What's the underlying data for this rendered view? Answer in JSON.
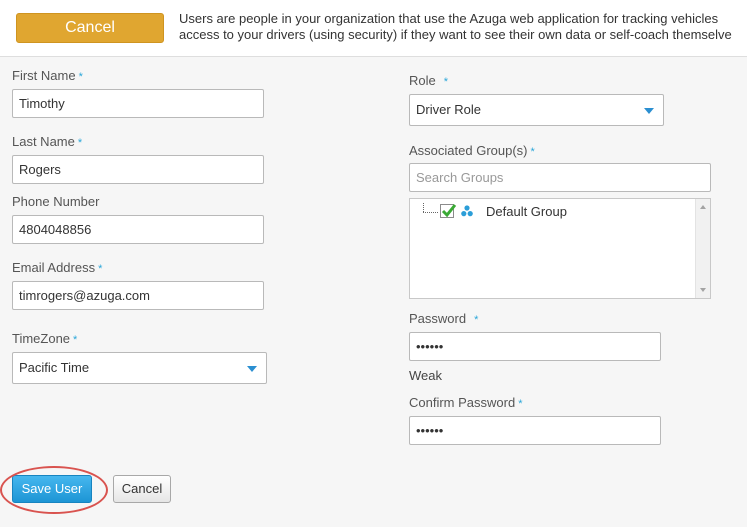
{
  "header": {
    "cancel_label": "Cancel",
    "info_line1": "Users are people in your organization that use the Azuga web application for tracking vehicles",
    "info_line2": "access to your drivers (using security) if they want to see their own data or self-coach themselve"
  },
  "form": {
    "required_mark": "*",
    "first_name": {
      "label": "First Name",
      "value": "Timothy"
    },
    "last_name": {
      "label": "Last Name",
      "value": "Rogers"
    },
    "phone": {
      "label": "Phone Number",
      "value": "4804048856"
    },
    "email": {
      "label": "Email Address",
      "value": "timrogers@azuga.com"
    },
    "timezone": {
      "label": "TimeZone",
      "value": "Pacific Time"
    },
    "role": {
      "label": "Role",
      "value": "Driver Role"
    },
    "groups": {
      "label": "Associated Group(s)",
      "search_placeholder": "Search Groups",
      "items": [
        {
          "label": "Default Group",
          "checked": true
        }
      ]
    },
    "password": {
      "label": "Password",
      "value": "••••••",
      "strength": "Weak"
    },
    "confirm_password": {
      "label": "Confirm Password",
      "value": "••••••"
    }
  },
  "actions": {
    "save_label": "Save User",
    "cancel_label": "Cancel"
  },
  "colors": {
    "accent_blue": "#29a6d9",
    "cancel_orange": "#e0a630",
    "highlight_red": "#d9534f"
  }
}
